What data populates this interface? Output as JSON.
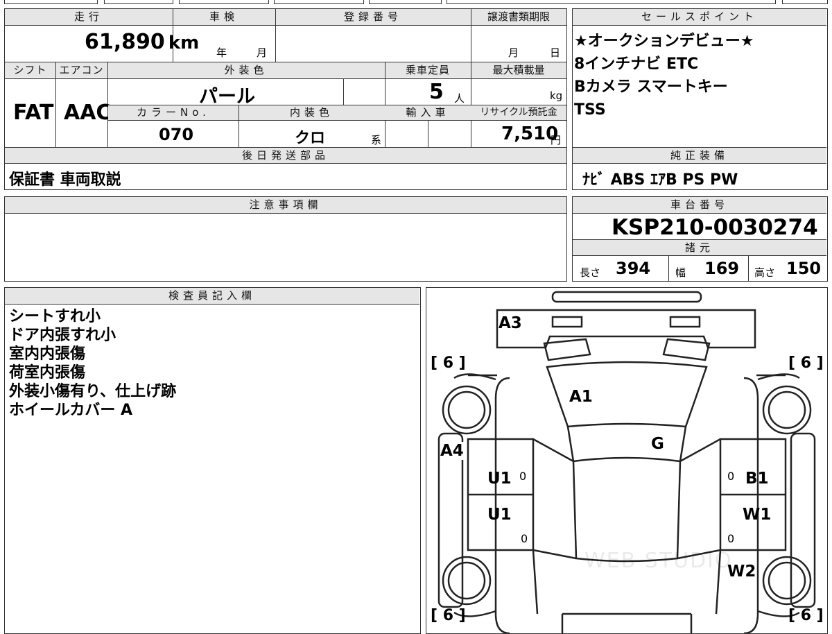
{
  "vehicle": {
    "mileage_label": "走行",
    "mileage_value": "61,890",
    "mileage_unit": "km",
    "inspection_label": "車検",
    "year_unit": "年",
    "month_unit": "月",
    "registration_label": "登録番号",
    "transfer_label": "譲渡書類期限",
    "transfer_month": "月",
    "transfer_day": "日",
    "shift_label": "シフト",
    "shift_value": "FAT",
    "ac_label": "エアコン",
    "ac_value": "AAC",
    "exterior_label": "外装色",
    "exterior_value": "パール",
    "capacity_label": "乗車定員",
    "capacity_value": "5",
    "capacity_unit": "人",
    "maxload_label": "最大積載量",
    "maxload_unit": "kg",
    "color_no_label": "カラーNo.",
    "color_no_value": "070",
    "interior_label": "内装色",
    "interior_value": "クロ",
    "interior_suffix": "系",
    "import_label": "輸入車",
    "recycle_label": "リサイクル預託金",
    "recycle_value": "7,510",
    "recycle_unit": "円"
  },
  "later_parts": {
    "label": "後日発送部品",
    "value": "保証書 車両取説"
  },
  "sales_points": {
    "label": "セールスポイント",
    "lines": [
      "★オークションデビュー★",
      "8インチナビ ETC",
      "Bカメラ スマートキー",
      "TSS"
    ]
  },
  "equipment": {
    "label": "純正装備",
    "value": "ﾅﾋﾞ ABS ｴｱB PS PW"
  },
  "caution": {
    "label": "注意事項欄"
  },
  "chassis": {
    "label": "車台番号",
    "value": "KSP210-0030274"
  },
  "specs": {
    "label": "諸元",
    "length_label": "長さ",
    "length_value": "394",
    "width_label": "幅",
    "width_value": "169",
    "height_label": "高さ",
    "height_value": "150"
  },
  "inspector": {
    "label": "検査員記入欄",
    "notes": [
      "シートすれ小",
      "ドア内張すれ小",
      "室内内張傷",
      "荷室内張傷",
      "外装小傷有り、仕上げ跡",
      "ホイールカバー A"
    ]
  },
  "diagram": {
    "tires": [
      "[ 6 ]",
      "[ 6 ]",
      "[ 6 ]",
      "[ 6 ]"
    ],
    "marks": {
      "a3": "A3",
      "a1": "A1",
      "g": "G",
      "a4": "A4",
      "u1_top": "U1",
      "u1_bottom": "U1",
      "b1": "B1",
      "w1": "W1",
      "w2": "W2",
      "zero": "0"
    },
    "watermark": "WEB STUDIO"
  }
}
